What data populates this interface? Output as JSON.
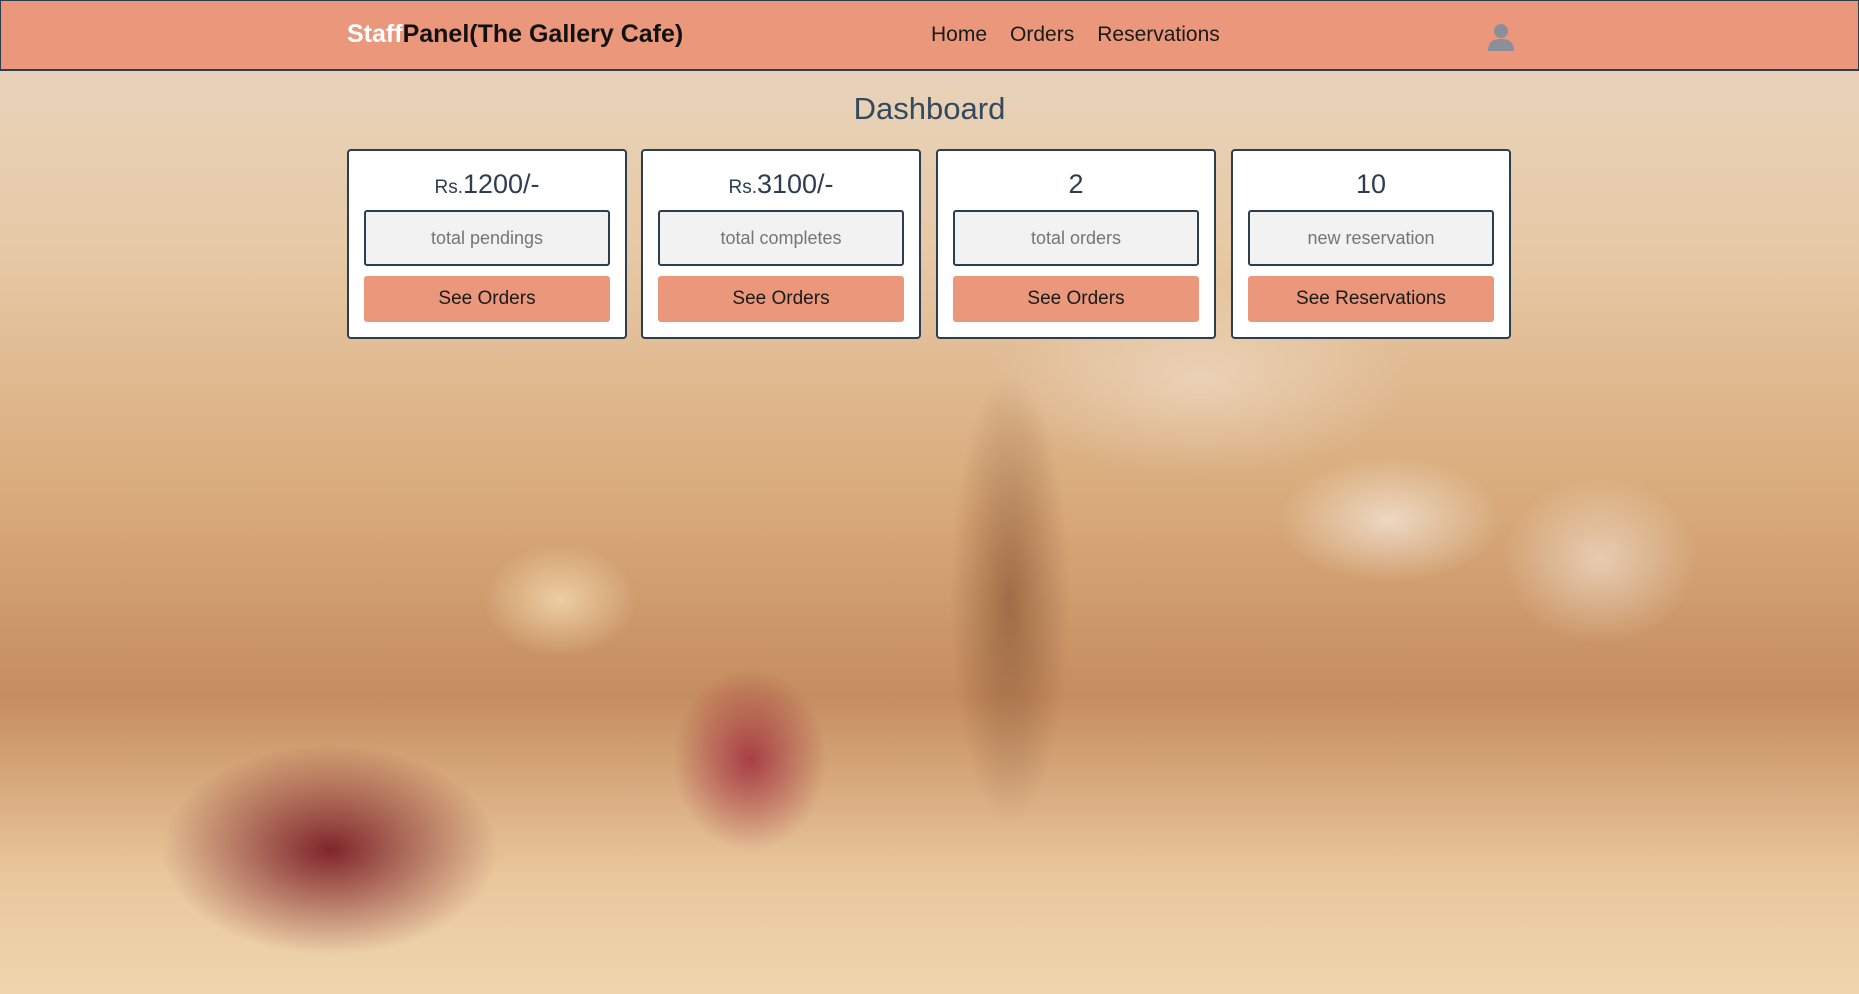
{
  "navbar": {
    "brand_highlight": "Staff",
    "brand_rest": "Panel(The Gallery Cafe)",
    "links": [
      "Home",
      "Orders",
      "Reservations"
    ],
    "user_icon": "user-icon"
  },
  "page": {
    "title": "Dashboard"
  },
  "cards": [
    {
      "prefix": "Rs.",
      "value": "1200/-",
      "placeholder": "total pendings",
      "button": "See Orders"
    },
    {
      "prefix": "Rs.",
      "value": "3100/-",
      "placeholder": "total completes",
      "button": "See Orders"
    },
    {
      "prefix": "",
      "value": "2",
      "placeholder": "total orders",
      "button": "See Orders"
    },
    {
      "prefix": "",
      "value": "10",
      "placeholder": "new reservation",
      "button": "See Reservations"
    }
  ],
  "colors": {
    "accent": "#ea977b",
    "dark": "#2c3e50",
    "title": "#34495e"
  }
}
